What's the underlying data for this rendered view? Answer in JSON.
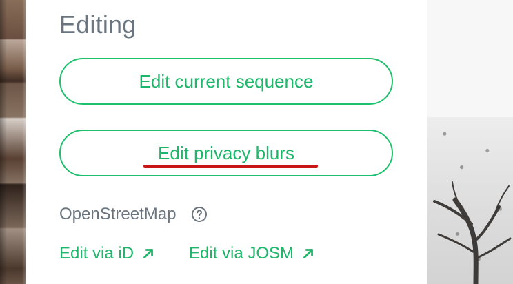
{
  "editing": {
    "title": "Editing",
    "buttons": {
      "edit_current_sequence": "Edit current sequence",
      "edit_privacy_blurs": "Edit privacy blurs"
    }
  },
  "osm": {
    "label": "OpenStreetMap",
    "help_icon": "help-circle-icon",
    "links": {
      "edit_via_id": "Edit via iD",
      "edit_via_josm": "Edit via JOSM"
    },
    "link_icon": "arrow-up-right-icon"
  },
  "sidebar_actions": [
    {
      "name": "tag-icon"
    },
    {
      "name": "comment-icon"
    },
    {
      "name": "share-icon"
    }
  ],
  "colors": {
    "accent_green": "#1db66a",
    "pill_border_green": "#1ec06c",
    "heading_gray": "#6a7580",
    "annotation_red": "#c81616"
  }
}
